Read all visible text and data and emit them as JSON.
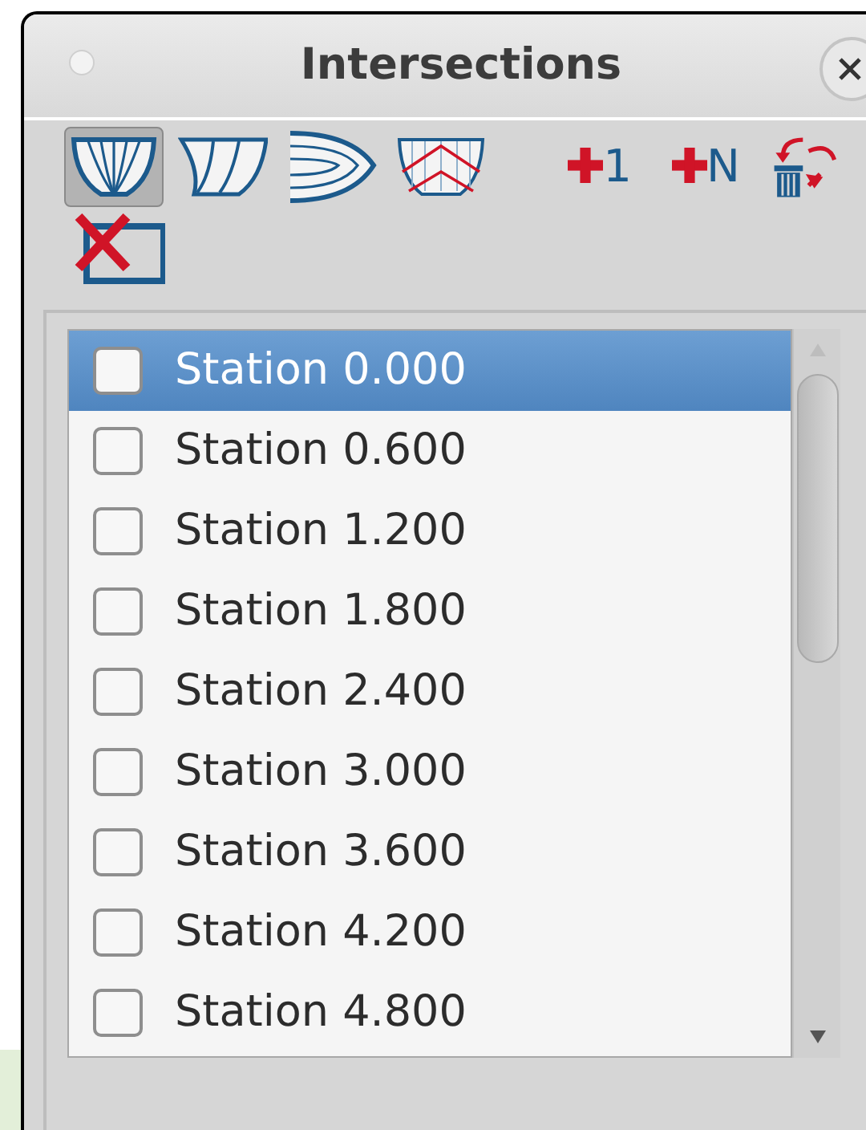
{
  "window": {
    "title": "Intersections"
  },
  "toolbar": [
    {
      "kind": "body-view",
      "selected": true
    },
    {
      "kind": "profile-view",
      "selected": false
    },
    {
      "kind": "plan-view",
      "selected": false
    },
    {
      "kind": "diagonal-view",
      "selected": false
    },
    {
      "kind": "add-one",
      "badge": "1"
    },
    {
      "kind": "add-many",
      "badge": "N"
    },
    {
      "kind": "delete-all"
    },
    {
      "kind": "clear"
    }
  ],
  "stations": [
    {
      "label": "Station 0.000",
      "checked": false,
      "selected": true
    },
    {
      "label": "Station 0.600",
      "checked": false,
      "selected": false
    },
    {
      "label": "Station 1.200",
      "checked": false,
      "selected": false
    },
    {
      "label": "Station 1.800",
      "checked": false,
      "selected": false
    },
    {
      "label": "Station 2.400",
      "checked": false,
      "selected": false
    },
    {
      "label": "Station 3.000",
      "checked": false,
      "selected": false
    },
    {
      "label": "Station 3.600",
      "checked": false,
      "selected": false
    },
    {
      "label": "Station 4.200",
      "checked": false,
      "selected": false
    },
    {
      "label": "Station 4.800",
      "checked": false,
      "selected": false
    }
  ]
}
